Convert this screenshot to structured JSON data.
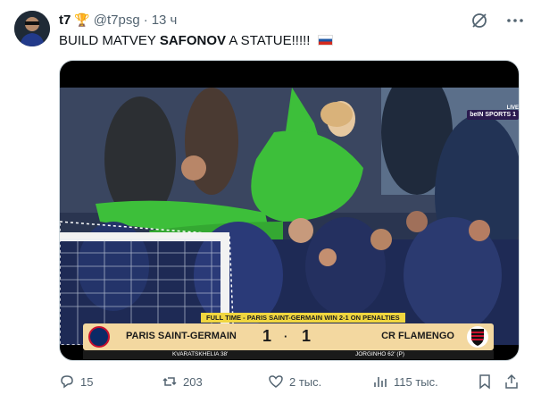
{
  "author": {
    "display_name": "t7",
    "trophy_icon": "trophy-icon",
    "handle": "@t7psg",
    "separator": "·",
    "time": "13 ч"
  },
  "tweet": {
    "text_part1": "BUILD MATVEY ",
    "text_bold": "SAFONOV",
    "text_part2": " A STATUE!!!!! ",
    "flag": "russia-flag-icon"
  },
  "header_icons": [
    "grok-icon",
    "more-icon"
  ],
  "media": {
    "broadcaster_live": "LIVE",
    "broadcaster": "beIN SPORTS 1",
    "result_banner": "FULL TIME - PARIS SAINT-GERMAIN WIN 2-1 ON PENALTIES",
    "home_team": "PARIS SAINT-GERMAIN",
    "home_score": "1",
    "away_team": "CR FLAMENGO",
    "away_score": "1",
    "home_scorer": "KVARATSKHELIA 38'",
    "away_scorer": "JORGINHO 62' (P)"
  },
  "actions": {
    "replies": "15",
    "reposts": "203",
    "likes": "2 тыс.",
    "views": "115 тыс."
  },
  "colors": {
    "muted": "#536471",
    "text": "#0f1419",
    "score_bar": "#f3d8a0",
    "banner": "#f0d63f",
    "goalkeeper_kit": "#3dbf3a"
  }
}
